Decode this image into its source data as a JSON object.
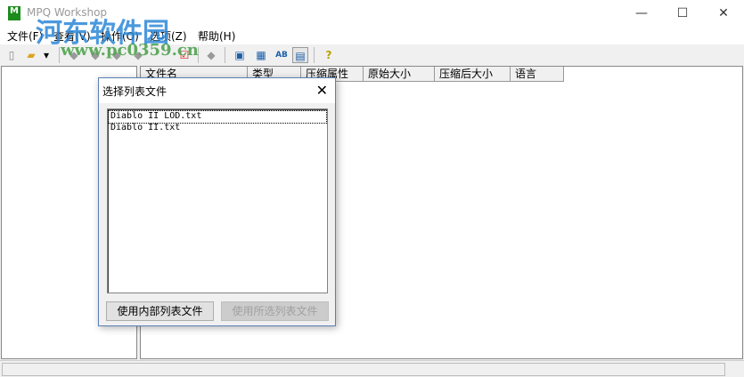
{
  "window": {
    "title": "MPQ Workshop",
    "minimize": "—",
    "maximize": "☐",
    "close": "✕"
  },
  "menu": [
    "文件(F)",
    "查看(V)",
    "操作(O)",
    "选项(Z)",
    "帮助(H)"
  ],
  "toolbar": {
    "help": "?"
  },
  "columns": [
    "文件名",
    "类型",
    "压缩属性",
    "原始大小",
    "压缩后大小",
    "语言"
  ],
  "dialog": {
    "title": "选择列表文件",
    "close": "✕",
    "items": [
      "Diablo II LOD.txt",
      "Diablo II.txt"
    ],
    "use_internal": "使用内部列表文件",
    "use_selected": "使用所选列表文件"
  },
  "watermark": {
    "text": "河东软件园",
    "url": "www.pc0359.cn"
  }
}
